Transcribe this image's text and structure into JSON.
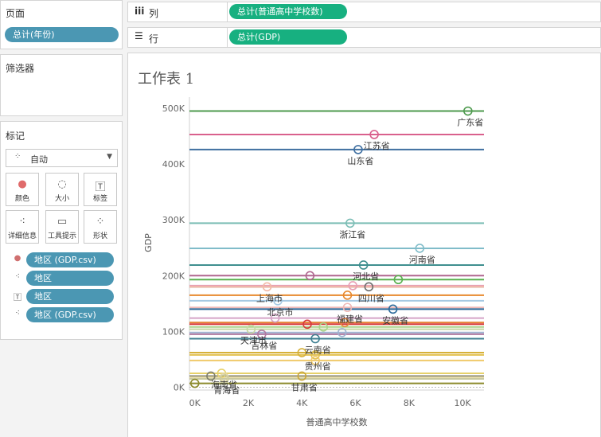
{
  "pages_panel": {
    "title": "页面",
    "pill": "总计(年份)"
  },
  "filters_panel": {
    "title": "筛选器"
  },
  "marks_panel": {
    "title": "标记",
    "mark_type": "自动",
    "buttons": [
      "颜色",
      "大小",
      "标签",
      "详细信息",
      "工具提示",
      "形状"
    ],
    "fields": [
      "地区 (GDP.csv)",
      "地区",
      "地区",
      "地区 (GDP.csv)"
    ]
  },
  "shelves": {
    "columns_label": "列",
    "columns_pill": "总计(普通高中学校数)",
    "rows_label": "行",
    "rows_pill": "总计(GDP)"
  },
  "sheet_title": "工作表 1",
  "chart_data": {
    "type": "scatter",
    "xlabel": "普通高中学校数",
    "ylabel": "GDP",
    "xlim": [
      -200,
      10800
    ],
    "ylim": [
      -5000,
      520000
    ],
    "xticks": [
      {
        "v": 0,
        "t": "0K"
      },
      {
        "v": 2000,
        "t": "2K"
      },
      {
        "v": 4000,
        "t": "4K"
      },
      {
        "v": 6000,
        "t": "6K"
      },
      {
        "v": 8000,
        "t": "8K"
      },
      {
        "v": 10000,
        "t": "10K"
      }
    ],
    "yticks": [
      {
        "v": 0,
        "t": "0K"
      },
      {
        "v": 100000,
        "t": "100K"
      },
      {
        "v": 200000,
        "t": "200K"
      },
      {
        "v": 300000,
        "t": "300K"
      },
      {
        "v": 400000,
        "t": "400K"
      },
      {
        "v": 500000,
        "t": "500K"
      }
    ],
    "points": [
      {
        "label": "广东省",
        "x": 10200,
        "y": 495000,
        "color": "#4e9a4e"
      },
      {
        "label": "江苏省",
        "x": 6700,
        "y": 453000,
        "color": "#d9608d"
      },
      {
        "label": "山东省",
        "x": 6100,
        "y": 426000,
        "color": "#3f6fa1"
      },
      {
        "label": "浙江省",
        "x": 5800,
        "y": 294000,
        "color": "#7bbdb5"
      },
      {
        "label": "河南省",
        "x": 8400,
        "y": 249000,
        "color": "#80bcc9"
      },
      {
        "label": "河北省",
        "x": 6300,
        "y": 219000,
        "color": "#3f8f8f"
      },
      {
        "label": "",
        "x": 7600,
        "y": 193000,
        "color": "#5ab04f"
      },
      {
        "label": "四川省",
        "x": 6500,
        "y": 180000,
        "color": "#6d6d6d"
      },
      {
        "label": "",
        "x": 4300,
        "y": 200000,
        "color": "#b0668f"
      },
      {
        "label": "",
        "x": 5900,
        "y": 182000,
        "color": "#e8a0b5"
      },
      {
        "label": "上海市",
        "x": 2700,
        "y": 180000,
        "color": "#f2b9a6"
      },
      {
        "label": "",
        "x": 5700,
        "y": 165000,
        "color": "#e8892e"
      },
      {
        "label": "北京市",
        "x": 3100,
        "y": 155000,
        "color": "#a6c9e3"
      },
      {
        "label": "福建省",
        "x": 5700,
        "y": 143000,
        "color": "#efb8b5"
      },
      {
        "label": "安徽省",
        "x": 7400,
        "y": 140000,
        "color": "#2c6a9b"
      },
      {
        "label": "",
        "x": 3000,
        "y": 124000,
        "color": "#d5a3c6"
      },
      {
        "label": "",
        "x": 5600,
        "y": 116000,
        "color": "#e6873a"
      },
      {
        "label": "",
        "x": 4200,
        "y": 113000,
        "color": "#d93a3a"
      },
      {
        "label": "",
        "x": 4800,
        "y": 108000,
        "color": "#a9d38a"
      },
      {
        "label": "天津市",
        "x": 2100,
        "y": 104000,
        "color": "#c6d8a3"
      },
      {
        "label": "",
        "x": 5500,
        "y": 98000,
        "color": "#9fb3d1"
      },
      {
        "label": "吉林省",
        "x": 2500,
        "y": 95000,
        "color": "#b07aa1"
      },
      {
        "label": "云南省",
        "x": 4500,
        "y": 87000,
        "color": "#3d7f91"
      },
      {
        "label": "",
        "x": 4000,
        "y": 62000,
        "color": "#d6b13a"
      },
      {
        "label": "贵州省",
        "x": 4500,
        "y": 58000,
        "color": "#e2c04d"
      },
      {
        "label": "",
        "x": 4500,
        "y": 48000,
        "color": "#f0c96b"
      },
      {
        "label": "海南省",
        "x": 1000,
        "y": 25000,
        "color": "#e6d16a"
      },
      {
        "label": "甘肃省",
        "x": 4000,
        "y": 20000,
        "color": "#c9a53a"
      },
      {
        "label": "",
        "x": 600,
        "y": 20000,
        "color": "#7f7f6a"
      },
      {
        "label": "",
        "x": 1100,
        "y": 18000,
        "color": "#e3d7a3"
      },
      {
        "label": "青海省",
        "x": 1100,
        "y": 15000,
        "color": "#c9c9a0"
      },
      {
        "label": "",
        "x": 0,
        "y": 7000,
        "color": "#8c8a2c"
      }
    ]
  }
}
